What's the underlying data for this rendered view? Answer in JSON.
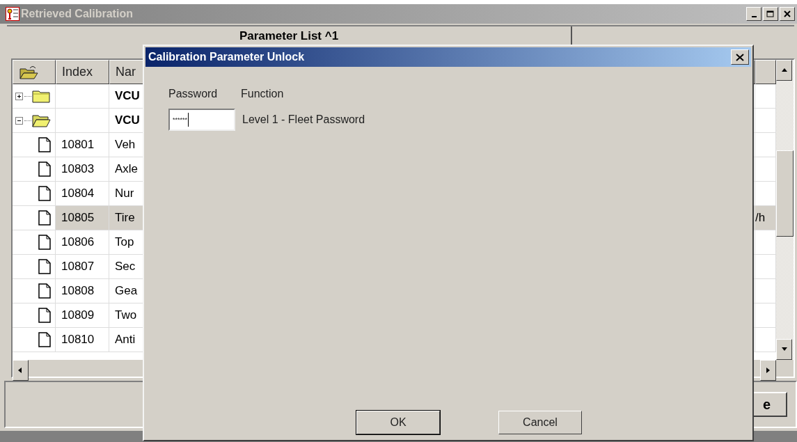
{
  "window": {
    "title": "Retrieved Calibration"
  },
  "panel": {
    "title": "Parameter List ^1"
  },
  "table": {
    "columns": [
      "Index",
      "Nar"
    ],
    "rows": [
      {
        "kind": "group",
        "expanded": false,
        "selected": false,
        "index": "",
        "name": "VCU",
        "column_4": ""
      },
      {
        "kind": "group",
        "expanded": true,
        "selected": false,
        "index": "",
        "name": "VCU",
        "column_4": ""
      },
      {
        "kind": "parameter",
        "selected": false,
        "index": "10801",
        "name": "Veh",
        "column_4": ""
      },
      {
        "kind": "parameter",
        "selected": false,
        "index": "10803",
        "name": "Axle",
        "column_4": ""
      },
      {
        "kind": "parameter",
        "selected": false,
        "index": "10804",
        "name": "Nur",
        "column_4": ""
      },
      {
        "kind": "parameter",
        "selected": true,
        "index": "10805",
        "name": "Tire",
        "column_4": "/h"
      },
      {
        "kind": "parameter",
        "selected": false,
        "index": "10806",
        "name": "Top",
        "column_4": ""
      },
      {
        "kind": "parameter",
        "selected": false,
        "index": "10807",
        "name": "Sec",
        "column_4": ""
      },
      {
        "kind": "parameter",
        "selected": false,
        "index": "10808",
        "name": "Gea",
        "column_4": ""
      },
      {
        "kind": "parameter",
        "selected": false,
        "index": "10809",
        "name": "Two",
        "column_4": ""
      },
      {
        "kind": "parameter",
        "selected": false,
        "index": "10810",
        "name": "Anti",
        "column_4": ""
      }
    ]
  },
  "bottom_button": {
    "label": "e"
  },
  "dialog": {
    "title": "Calibration Parameter Unlock",
    "headers": [
      "Password",
      "Function"
    ],
    "entries": [
      {
        "value": "******",
        "function": "Level 1 - Fleet Password"
      }
    ],
    "buttons": [
      {
        "label": "OK",
        "default": true
      },
      {
        "label": "Cancel",
        "default": false
      }
    ]
  }
}
